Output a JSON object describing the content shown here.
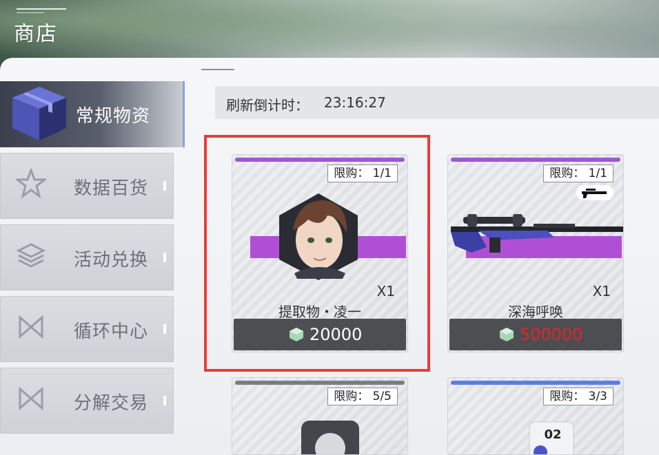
{
  "header": {
    "title": "商店"
  },
  "sidebar": {
    "active": {
      "label": "常规物资"
    },
    "items": [
      {
        "label": "数据百货"
      },
      {
        "label": "活动兑换"
      },
      {
        "label": "循环中心"
      },
      {
        "label": "分解交易"
      }
    ]
  },
  "timer": {
    "label": "刷新倒计时：",
    "value": "23:16:27"
  },
  "items": [
    {
      "limit": "限购： 1/1",
      "qty": "X1",
      "name": "提取物・凌一",
      "price": "20000",
      "price_color": "#ffffff",
      "bar_color": "#9b59d0"
    },
    {
      "limit": "限购： 1/1",
      "qty": "X1",
      "name": "深海呼唤",
      "price": "500000",
      "price_color": "#e0262b",
      "bar_color": "#9b59d0"
    },
    {
      "limit": "限购： 5/5",
      "bar_color": "#7a7d84"
    },
    {
      "limit": "限购： 3/3",
      "bar_color": "#5b7fe0"
    }
  ],
  "colors": {
    "highlight": "#e83b3b",
    "rarity_purple": "#b04fd6",
    "rarity_blue": "#5b7fe0"
  }
}
